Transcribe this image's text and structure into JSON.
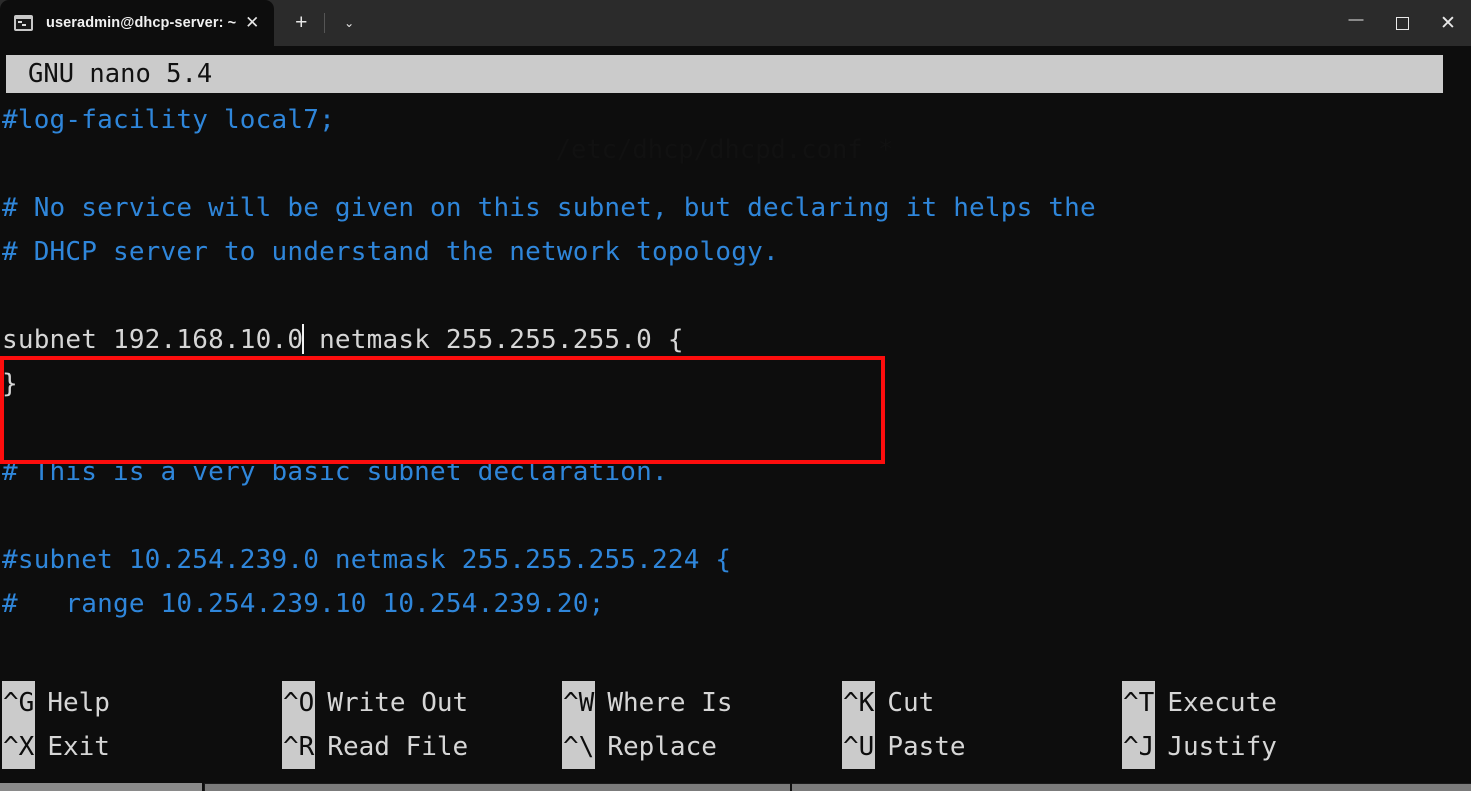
{
  "window": {
    "tab": {
      "title": "useradmin@dhcp-server: ~",
      "icon": "terminal-icon",
      "close_label": "✕"
    },
    "new_tab_label": "+",
    "tab_menu_label": "⌄",
    "controls": {
      "minimize": "—",
      "maximize": "",
      "close": "✕"
    }
  },
  "nano": {
    "header": {
      "version": "GNU nano 5.4",
      "filename": "/etc/dhcp/dhcpd.conf *"
    },
    "lines": [
      {
        "text": "#log-facility local7;",
        "kind": "comment"
      },
      {
        "text": "",
        "kind": "blank"
      },
      {
        "text": "# No service will be given on this subnet, but declaring it helps the",
        "kind": "comment"
      },
      {
        "text": "# DHCP server to understand the network topology.",
        "kind": "comment"
      },
      {
        "text": "",
        "kind": "blank"
      },
      {
        "text": "subnet 192.168.10.0 netmask 255.255.255.0 {",
        "kind": "code",
        "cursor_after": 19
      },
      {
        "text": "}",
        "kind": "code"
      },
      {
        "text": "",
        "kind": "blank"
      },
      {
        "text": "# This is a very basic subnet declaration.",
        "kind": "comment"
      },
      {
        "text": "",
        "kind": "blank"
      },
      {
        "text": "#subnet 10.254.239.0 netmask 255.255.255.224 {",
        "kind": "comment"
      },
      {
        "text": "#   range 10.254.239.10 10.254.239.20;",
        "kind": "comment"
      }
    ],
    "shortcuts": [
      {
        "key": "^G",
        "label": "Help"
      },
      {
        "key": "^O",
        "label": "Write Out"
      },
      {
        "key": "^W",
        "label": "Where Is"
      },
      {
        "key": "^K",
        "label": "Cut"
      },
      {
        "key": "^T",
        "label": "Execute"
      },
      {
        "key": "^X",
        "label": "Exit"
      },
      {
        "key": "^R",
        "label": "Read File"
      },
      {
        "key": "^\\",
        "label": "Replace"
      },
      {
        "key": "^U",
        "label": "Paste"
      },
      {
        "key": "^J",
        "label": "Justify"
      }
    ]
  },
  "annotation": {
    "type": "highlight-rectangle",
    "color": "#fc0d0d",
    "targets": "subnet 192.168.10.0 netmask 255.255.255.0 { }"
  },
  "colors": {
    "terminal_background": "#0d0d0d",
    "comment_text": "#2f86da",
    "code_text": "#d6d6d6",
    "header_background": "#cbcbcb",
    "header_text": "#111111",
    "titlebar_background": "#2b2b2b",
    "annotation_red": "#fc0d0d"
  }
}
